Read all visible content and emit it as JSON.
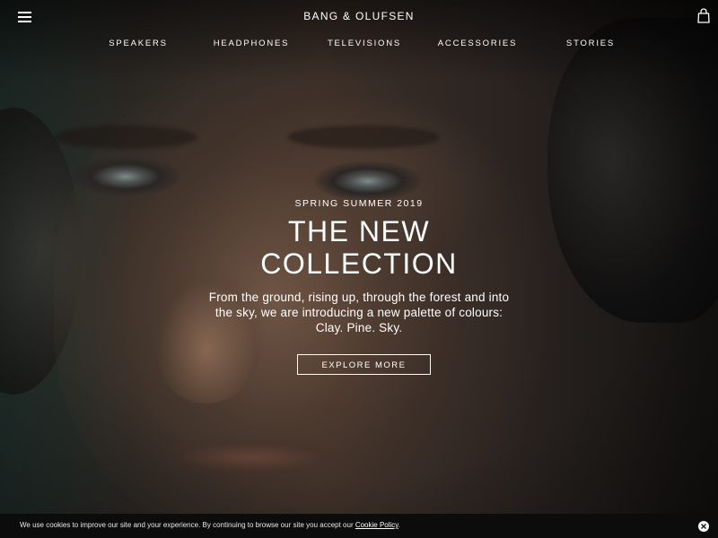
{
  "header": {
    "brand": "BANG & OLUFSEN",
    "menu_icon": "hamburger-menu-icon",
    "bag_icon": "shopping-bag-icon"
  },
  "nav": {
    "items": [
      {
        "label": "SPEAKERS"
      },
      {
        "label": "HEADPHONES"
      },
      {
        "label": "TELEVISIONS"
      },
      {
        "label": "ACCESSORIES"
      },
      {
        "label": "STORIES"
      }
    ]
  },
  "hero": {
    "eyebrow": "SPRING SUMMER 2019",
    "headline_line1": "THE NEW",
    "headline_line2": "COLLECTION",
    "body": "From the ground, rising up, through the forest and into the sky, we are introducing a new palette of colours: Clay. Pine. Sky.",
    "cta_label": "EXPLORE MORE"
  },
  "cookie": {
    "text": "We use cookies to improve our site and your experience. By continuing to browse our site you accept our ",
    "link_label": "Cookie Policy",
    "suffix": ".",
    "close_icon": "close-icon"
  },
  "colors": {
    "text": "#ffffff",
    "cookie_bar_bg": "#0c0c0c"
  }
}
